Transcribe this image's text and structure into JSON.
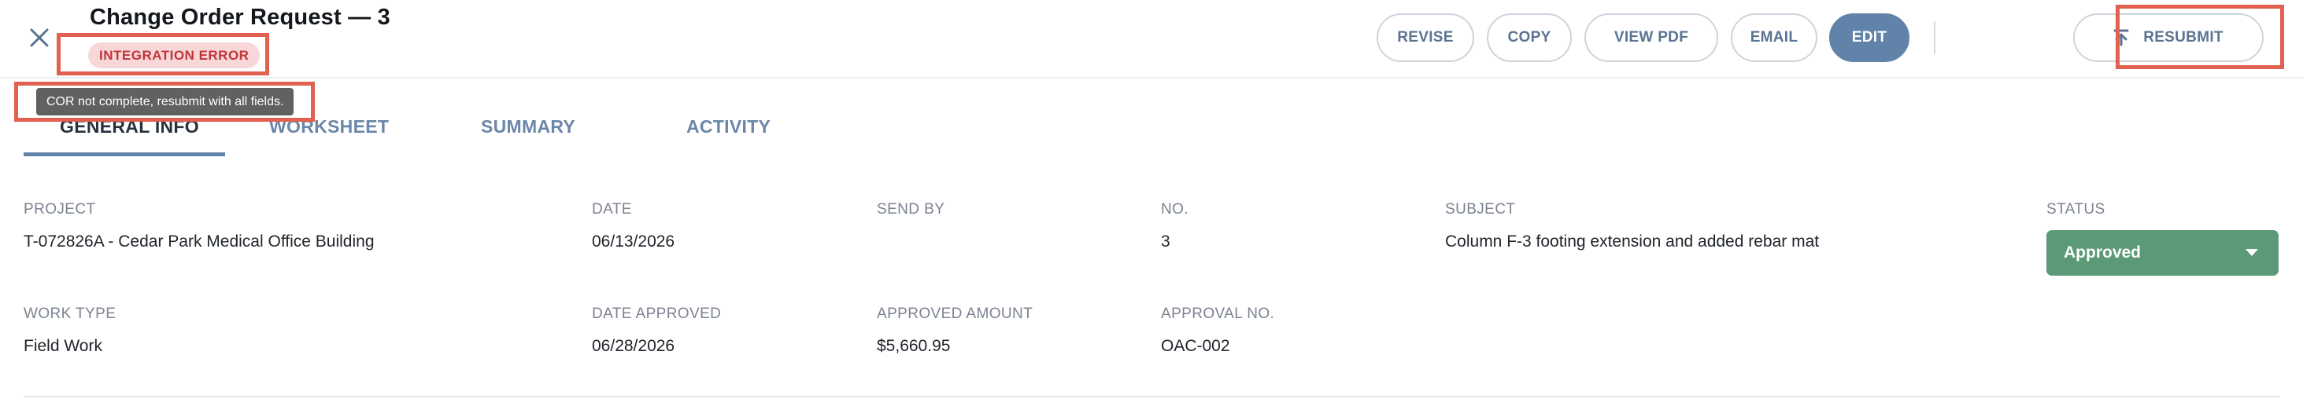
{
  "header": {
    "title": "Change Order Request — 3",
    "status_badge": "INTEGRATION ERROR"
  },
  "actions": {
    "revise": "REVISE",
    "copy": "COPY",
    "view_pdf": "VIEW PDF",
    "email": "EMAIL",
    "edit": "EDIT",
    "resubmit": "RESUBMIT"
  },
  "tooltip": "COR not complete, resubmit with all fields.",
  "tabs": [
    {
      "label": "GENERAL INFO",
      "active": true
    },
    {
      "label": "WORKSHEET",
      "active": false
    },
    {
      "label": "SUMMARY",
      "active": false
    },
    {
      "label": "ACTIVITY",
      "active": false
    }
  ],
  "fields": {
    "project": {
      "label": "PROJECT",
      "value": "T-072826A - Cedar Park Medical Office Building"
    },
    "date": {
      "label": "DATE",
      "value": "06/13/2026"
    },
    "send_by": {
      "label": "SEND BY",
      "value": ""
    },
    "no": {
      "label": "NO.",
      "value": "3"
    },
    "subject": {
      "label": "SUBJECT",
      "value": "Column F-3 footing extension and added rebar mat"
    },
    "status": {
      "label": "STATUS",
      "value": "Approved"
    },
    "work_type": {
      "label": "WORK TYPE",
      "value": "Field Work"
    },
    "date_approved": {
      "label": "DATE APPROVED",
      "value": "06/28/2026"
    },
    "approved_amount": {
      "label": "APPROVED AMOUNT",
      "value": "$5,660.95"
    },
    "approval_no": {
      "label": "APPROVAL NO.",
      "value": "OAC-002"
    }
  },
  "colors": {
    "accent": "#6283a9",
    "error_bg": "#f7d7d7",
    "error_text": "#c0363c",
    "status_approved": "#5c9a77",
    "highlight": "#e2604f"
  },
  "icons": {
    "close": "close-icon",
    "resubmit": "upload-icon",
    "status_caret": "caret-down-icon"
  }
}
